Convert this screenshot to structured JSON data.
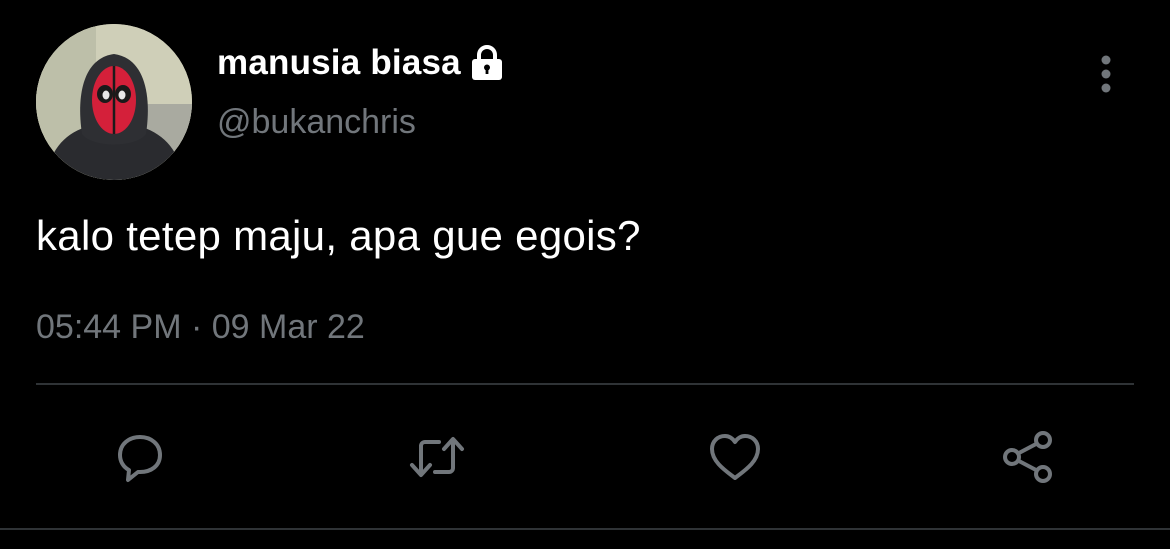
{
  "tweet": {
    "display_name": "manusia biasa",
    "handle": "@bukanchris",
    "text": "kalo tetep maju, apa gue egois?",
    "timestamp": "05:44 PM · 09 Mar 22",
    "icons": {
      "lock": "lock-icon",
      "more": "more-options-icon",
      "reply": "reply-icon",
      "retweet": "retweet-icon",
      "like": "heart-icon",
      "share": "share-icon"
    }
  },
  "colors": {
    "background": "#000000",
    "primary_text": "#ffffff",
    "secondary_text": "#71767b",
    "divider": "#2f3336",
    "avatar_mask": "#d4203a"
  }
}
